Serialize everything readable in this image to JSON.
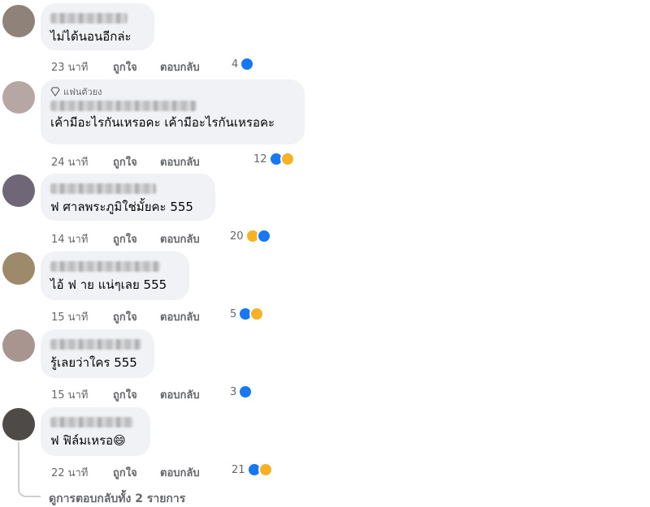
{
  "labels": {
    "like": "ถูกใจ",
    "reply": "ตอบกลับ"
  },
  "fan_badge": "แฟนตัวยง",
  "comments": [
    {
      "text": "ไม่ได้นอนอีกล่ะ",
      "time": "23 นาที",
      "count": "4",
      "reactions": [
        "like"
      ]
    },
    {
      "text": "เค้ามีอะไรกันเหรอคะ เค้ามีอะไรกันเหรอคะ",
      "time": "24 นาที",
      "count": "12",
      "reactions": [
        "like",
        "haha"
      ]
    },
    {
      "text": "ฟ ศาลพระภูมิใช่มั้ยคะ 555",
      "time": "14 นาที",
      "count": "20",
      "reactions": [
        "haha",
        "like"
      ]
    },
    {
      "text": "ไอ้ ฟ าย แน่ๆเลย 555",
      "time": "15 นาที",
      "count": "5",
      "reactions": [
        "like",
        "haha"
      ]
    },
    {
      "text": "รู้เลยว่าใคร 555",
      "time": "15 นาที",
      "count": "3",
      "reactions": [
        "like"
      ]
    },
    {
      "text": "ฟ ฟิล์มเหรอ",
      "text_emoji": "😄",
      "time": "22 นาที",
      "count": "21",
      "reactions": [
        "like",
        "haha"
      ]
    }
  ],
  "view_replies": "ดูการตอบกลับทั้ง 2 รายการ",
  "colors": {
    "like_blue": "#1877f2",
    "haha_yellow": "#f7b125",
    "bubble": "#f0f2f5",
    "meta_gray": "#65676b"
  }
}
